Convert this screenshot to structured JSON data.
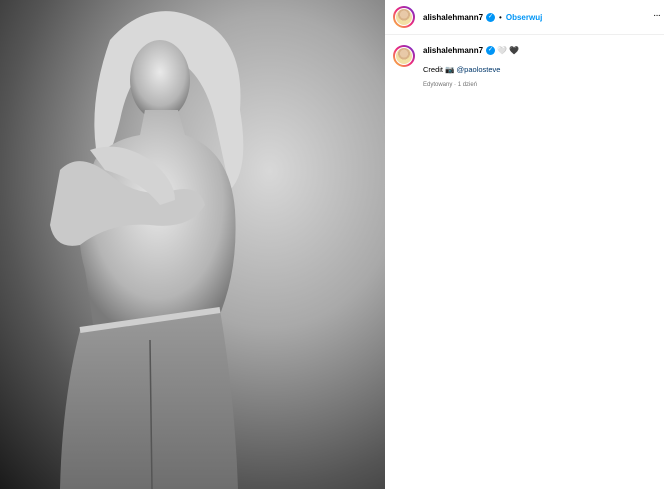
{
  "post": {
    "username": "alishalehmann7",
    "separator": "•",
    "follow_label": "Obserwuj",
    "more_label": "···"
  },
  "comment": {
    "username": "alishalehmann7",
    "emojis": [
      "🤍",
      "🖤"
    ],
    "caption_word": "Credit",
    "caption_emoji": "📷",
    "mention": "@paolosteve",
    "edited_label": "Edytowany",
    "meta_separator": "·",
    "time": "1 dzień"
  },
  "colors": {
    "accent": "#0095f6",
    "meta": "#737373",
    "mention": "#00376b"
  },
  "icons": {
    "verified": "verified-badge-icon",
    "more": "more-options-icon"
  }
}
